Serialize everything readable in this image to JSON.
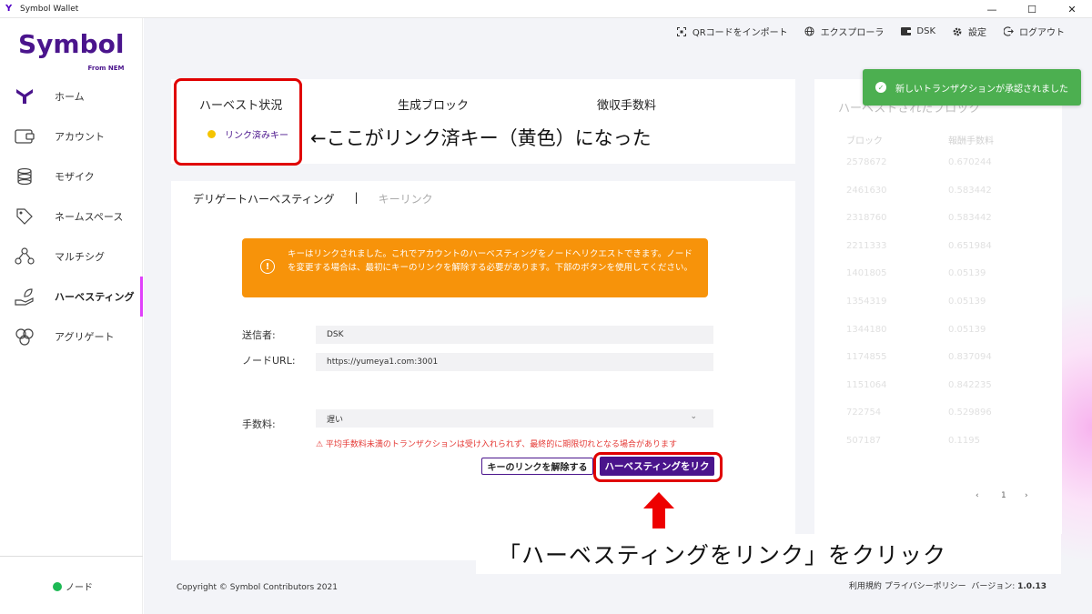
{
  "window": {
    "title": "Symbol Wallet",
    "controls": [
      "—",
      "☐",
      "✕"
    ]
  },
  "logo": {
    "text": "Symbol",
    "sub": "From NEM"
  },
  "sidebar": {
    "items": [
      {
        "label": "ホーム",
        "icon": "home-icon"
      },
      {
        "label": "アカウント",
        "icon": "wallet-icon"
      },
      {
        "label": "モザイク",
        "icon": "mosaic-icon"
      },
      {
        "label": "ネームスペース",
        "icon": "tag-icon"
      },
      {
        "label": "マルチシグ",
        "icon": "multisig-icon"
      },
      {
        "label": "ハーベスティング",
        "icon": "harvest-icon",
        "active": true
      },
      {
        "label": "アグリゲート",
        "icon": "aggregate-icon"
      }
    ],
    "node": {
      "label": "ノード",
      "status_color": "#1db954"
    }
  },
  "topnav": {
    "qr": "QRコードをインポート",
    "explorer": "エクスプローラ",
    "account": "DSK",
    "settings": "設定",
    "logout": "ログアウト"
  },
  "toast": {
    "text": "新しいトランザクションが承認されました",
    "color": "#4caf50"
  },
  "status_card": {
    "harvest_status": "ハーベスト状況",
    "generated_blocks": "生成ブロック",
    "fees": "徴収手数料",
    "linked_key": "リンク済みキー",
    "dot_color": "#f5c400"
  },
  "annotation1": "←ここがリンク済キー（黄色）になった",
  "tabs": {
    "delegated": "デリゲートハーベスティング",
    "separator": "|",
    "keylink": "キーリンク"
  },
  "alert": {
    "icon": "info-icon",
    "text": "キーはリンクされました。これでアカウントのハーベスティングをノードへリクエストできます。ノードを変更する場合は、最初にキーのリンクを解除する必要があります。下部のボタンを使用してください。",
    "color": "#f7930a"
  },
  "form": {
    "sender_label": "送信者:",
    "sender_value": "DSK",
    "node_url_label": "ノードURL:",
    "node_url_value": "https://yumeya1.com:3001",
    "fee_label": "手数料:",
    "fee_value": "遅い",
    "fee_warning": "⚠ 平均手数料未満のトランザクションは受け入れられず、最終的に期限切れとなる場合があります"
  },
  "buttons": {
    "unlink": "キーのリンクを解除する",
    "link": "ハーベスティングをリク"
  },
  "annotation2": "「ハーベスティングをリンク」をクリック",
  "right_panel": {
    "title": "ハーベストされたブロック",
    "col_block": "ブロック",
    "col_fee": "報酬手数料",
    "rows": [
      [
        "2578672",
        "0.670244"
      ],
      [
        "2461630",
        "0.583442"
      ],
      [
        "2318760",
        "0.583442"
      ],
      [
        "2211333",
        "0.651984"
      ],
      [
        "1401805",
        "0.05139"
      ],
      [
        "1354319",
        "0.05139"
      ],
      [
        "1344180",
        "0.05139"
      ],
      [
        "1174855",
        "0.837094"
      ],
      [
        "1151064",
        "0.842235"
      ],
      [
        "722754",
        "0.529896"
      ],
      [
        "507187",
        "0.1195"
      ]
    ],
    "page": "1"
  },
  "footer": {
    "copyright": "Copyright © Symbol Contributors 2021",
    "terms": "利用規約",
    "privacy": "プライバシーポリシー",
    "version_label": "バージョン:",
    "version": "1.0.13"
  }
}
